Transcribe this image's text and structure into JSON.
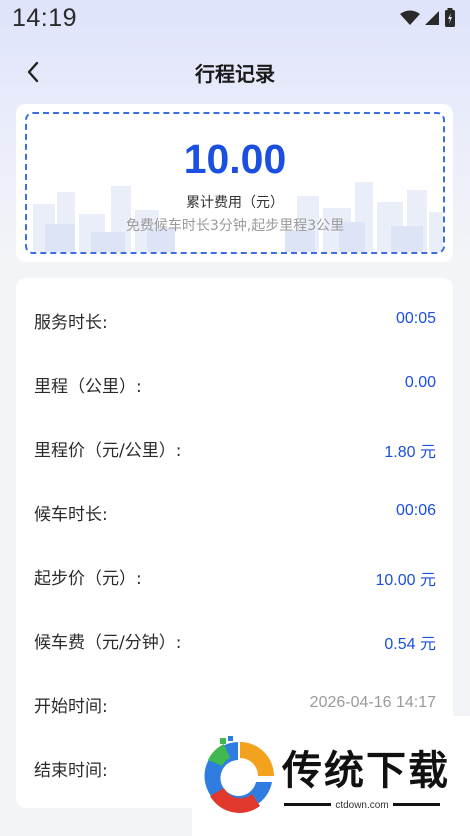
{
  "status_bar": {
    "time": "14:19",
    "icons": [
      "wifi-icon",
      "signal-icon",
      "battery-icon"
    ]
  },
  "nav": {
    "title": "行程记录",
    "back_icon": "chevron-left-icon"
  },
  "summary": {
    "amount": "10.00",
    "label": "累计费用（元）",
    "note": "免费候车时长3分钟,起步里程3公里"
  },
  "details": [
    {
      "label": "服务时长:",
      "value": "00:05"
    },
    {
      "label": "里程（公里）:",
      "value": "0.00"
    },
    {
      "label": "里程价（元/公里）:",
      "value": "1.80 元"
    },
    {
      "label": "候车时长:",
      "value": "00:06"
    },
    {
      "label": "起步价（元）:",
      "value": "10.00 元"
    },
    {
      "label": "候车费（元/分钟）:",
      "value": "0.54 元"
    },
    {
      "label": "开始时间:",
      "value": "2026-04-16 14:17"
    },
    {
      "label": "结束时间:",
      "value": ""
    }
  ],
  "watermark": {
    "brand": "传统下载",
    "domain": "ctdown.com"
  },
  "colors": {
    "accent": "#1b4fe0",
    "muted": "#9a9a9a",
    "text": "#2b2b2b"
  }
}
